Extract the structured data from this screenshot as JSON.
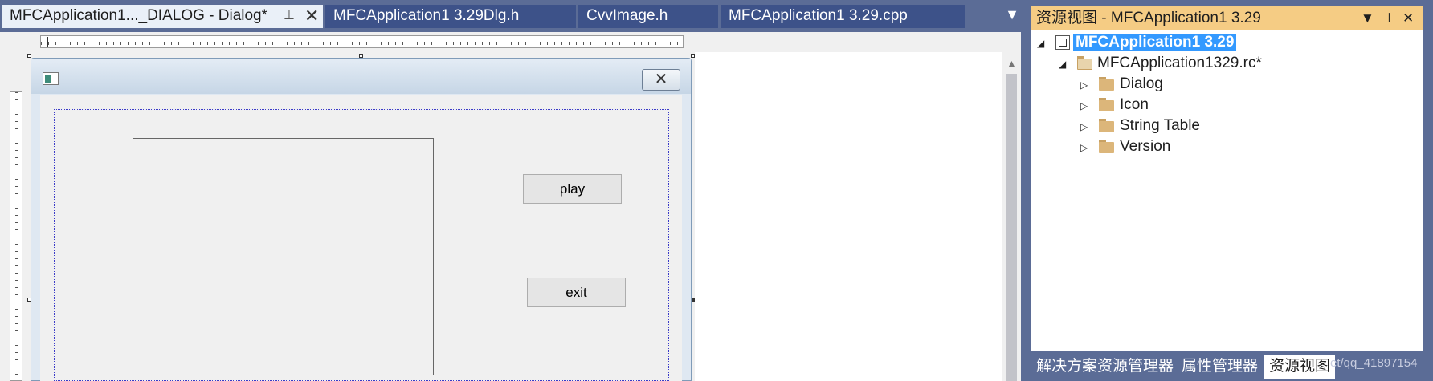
{
  "tabs": [
    {
      "label": "MFCApplication1..._DIALOG - Dialog*",
      "active": true
    },
    {
      "label": "MFCApplication1 3.29Dlg.h",
      "active": false
    },
    {
      "label": "CvvImage.h",
      "active": false
    },
    {
      "label": "MFCApplication1 3.29.cpp",
      "active": false
    }
  ],
  "tab_icons": {
    "pin": "pin-icon",
    "close": "close-icon",
    "overflow": "dropdown-icon"
  },
  "dialog": {
    "close_glyph": "✕",
    "buttons": {
      "play": "play",
      "exit": "exit"
    }
  },
  "resource_view": {
    "title": "资源视图 - MFCApplication1 3.29",
    "tree": {
      "root": "MFCApplication1 3.29",
      "rc_file": "MFCApplication1329.rc*",
      "folders": [
        "Dialog",
        "Icon",
        "String Table",
        "Version"
      ]
    },
    "bottom_tabs": [
      "解决方案资源管理器",
      "属性管理器",
      "资源视图"
    ],
    "watermark": "et/qq_41897154"
  },
  "colors": {
    "chrome": "#5b6c96",
    "active_tab": "#eaf0f8",
    "inactive_tab": "#3d5289",
    "panel_header": "#f5cc84",
    "selection": "#3399ff",
    "folder": "#dcb67a"
  }
}
